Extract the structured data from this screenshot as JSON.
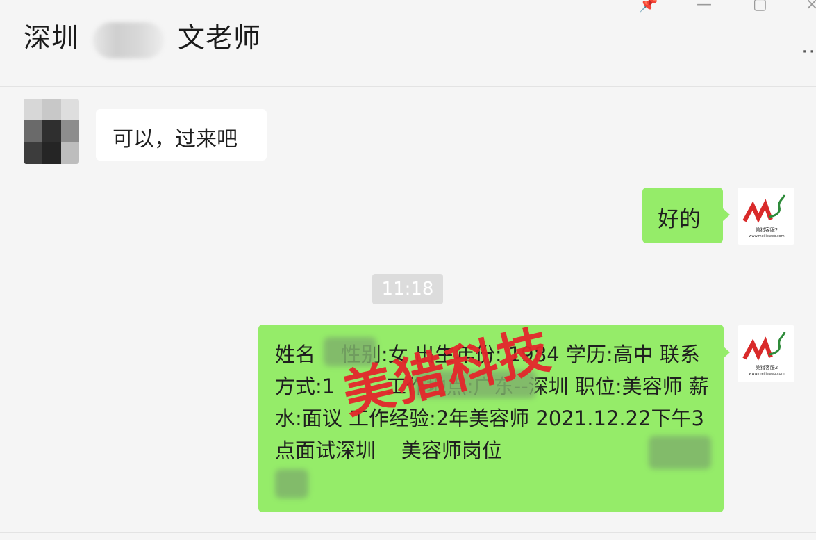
{
  "header": {
    "title_prefix": "深圳",
    "title_suffix": "文老师",
    "pin_icon": "📌",
    "minimize_icon": "—",
    "maximize_icon": "▢",
    "close_icon": "×",
    "more_icon": "··"
  },
  "messages": [
    {
      "side": "left",
      "text": "可以，过来吧"
    },
    {
      "side": "right",
      "text": "好的"
    },
    {
      "side": "system",
      "text": "11:18"
    },
    {
      "side": "right",
      "text": "姓名    性别:女 出生年份: 1984 学历:高中 联系方式:1        工作地点:广东--深圳 职位:美容师 薪水:面议 工作经验:2年美容师 2021.12.22下午3点面试深圳    美容师岗位"
    }
  ],
  "avatar_logo_text": "美猎客服2",
  "avatar_logo_sub": "www.meilieweb.com",
  "watermark": "美猎科技",
  "colors": {
    "bubble_self": "#95ec69",
    "bubble_other": "#ffffff",
    "background": "#f5f5f5",
    "watermark": "#e4262b"
  }
}
